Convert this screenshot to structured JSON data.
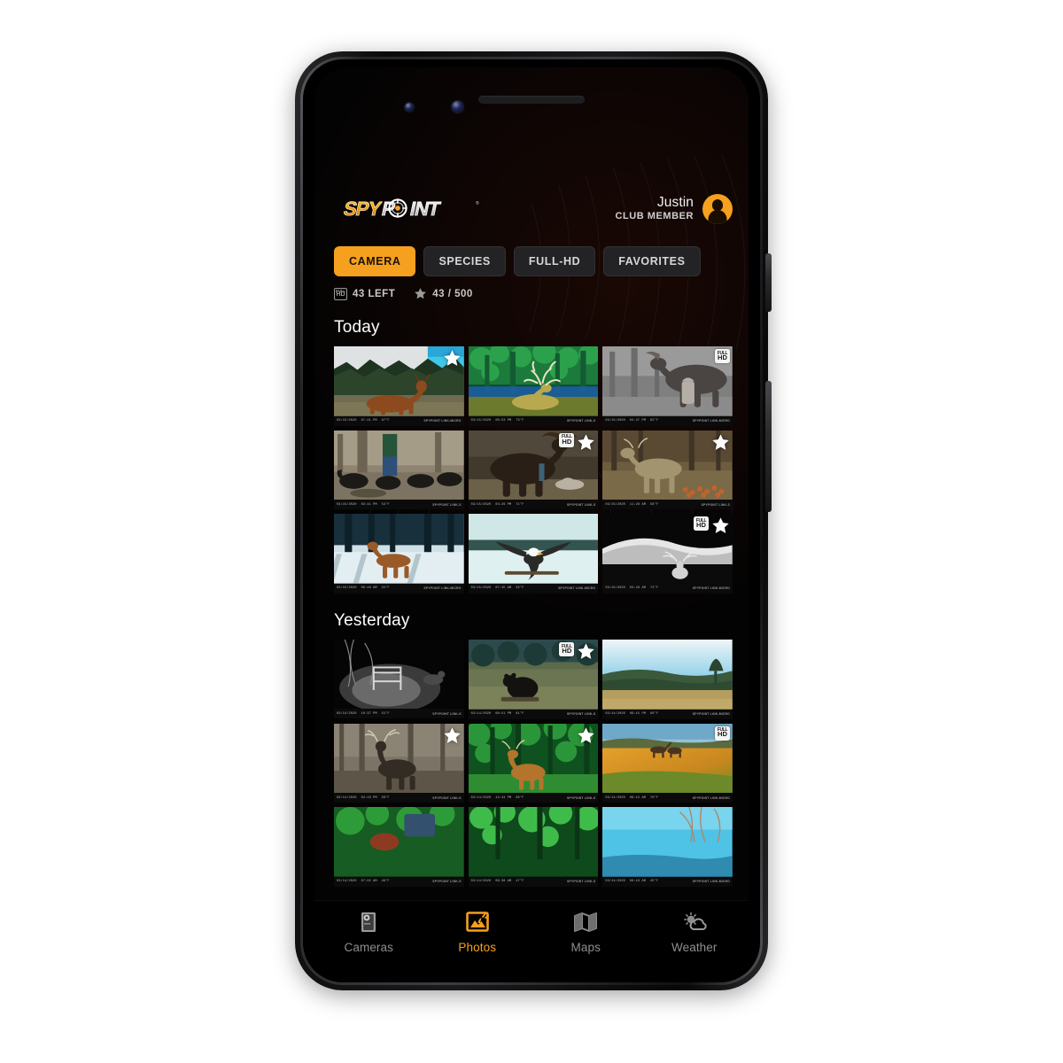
{
  "app": {
    "brand": "SPYPOINT",
    "brand_parts": {
      "orange": "SPY",
      "white": "INT",
      "target_letter": "P"
    }
  },
  "header": {
    "user_name": "Justin",
    "user_role": "CLUB MEMBER",
    "avatar_icon": "person-avatar-icon"
  },
  "filters": {
    "chips": [
      {
        "label": "CAMERA",
        "active": true
      },
      {
        "label": "SPECIES",
        "active": false
      },
      {
        "label": "FULL-HD",
        "active": false
      },
      {
        "label": "FAVORITES",
        "active": false
      }
    ]
  },
  "counters": {
    "hd": {
      "icon": "full-hd-icon",
      "label": "43 LEFT"
    },
    "favorites": {
      "icon": "star-icon",
      "label": "43 / 500"
    }
  },
  "sections": [
    {
      "title": "Today",
      "photos": [
        {
          "id": "t1",
          "scene": "buck-field-day",
          "hd": false,
          "fav": true,
          "timestamp": "03/15/2020",
          "time": "07:21 PM",
          "temp": "67°F",
          "mark": "SPYPOINT LINK-MICRO"
        },
        {
          "id": "t2",
          "scene": "buck-green-night",
          "hd": false,
          "fav": false,
          "timestamp": "03/15/2020",
          "time": "06:53 PM",
          "temp": "73°F",
          "mark": "SPYPOINT LINK-S"
        },
        {
          "id": "t3",
          "scene": "moose-gray",
          "hd": true,
          "fav": false,
          "timestamp": "03/15/2020",
          "time": "04:37 PM",
          "temp": "62°F",
          "mark": "SPYPOINT LINK-MICRO"
        },
        {
          "id": "t4",
          "scene": "boars-feeder",
          "hd": false,
          "fav": false,
          "timestamp": "03/15/2020",
          "time": "03:41 PM",
          "temp": "54°F",
          "mark": "SPYPOINT LINK-S"
        },
        {
          "id": "t5",
          "scene": "moose-dark",
          "hd": true,
          "fav": true,
          "timestamp": "03/15/2020",
          "time": "03:26 PM",
          "temp": "71°F",
          "mark": "SPYPOINT LINK-S"
        },
        {
          "id": "t6",
          "scene": "deer-apples",
          "hd": false,
          "fav": true,
          "timestamp": "03/15/2020",
          "time": "11:28 AM",
          "temp": "58°F",
          "mark": "SPYPOINT LINK-S"
        },
        {
          "id": "t7",
          "scene": "deer-snow",
          "hd": false,
          "fav": false,
          "timestamp": "03/15/2020",
          "time": "09:48 AM",
          "temp": "34°F",
          "mark": "SPYPOINT LINK-MICRO"
        },
        {
          "id": "t8",
          "scene": "eagle-snow",
          "hd": false,
          "fav": false,
          "timestamp": "03/15/2020",
          "time": "07:45 AM",
          "temp": "32°F",
          "mark": "SPYPOINT LINK-MICRO"
        },
        {
          "id": "t9",
          "scene": "buck-night-bw",
          "hd": true,
          "fav": true,
          "timestamp": "03/15/2020",
          "time": "03:28 AM",
          "temp": "72°F",
          "mark": "SPYPOINT LINK-MICRO"
        }
      ]
    },
    {
      "title": "Yesterday",
      "photos": [
        {
          "id": "y1",
          "scene": "night-stand-bw",
          "hd": false,
          "fav": false,
          "timestamp": "03/14/2020",
          "time": "10:37 PM",
          "temp": "51°F",
          "mark": "SPYPOINT LINK-S"
        },
        {
          "id": "y2",
          "scene": "bear-field",
          "hd": true,
          "fav": true,
          "timestamp": "03/14/2020",
          "time": "08:51 PM",
          "temp": "61°F",
          "mark": "SPYPOINT LINK-S"
        },
        {
          "id": "y3",
          "scene": "sky-meadow",
          "hd": false,
          "fav": false,
          "timestamp": "03/14/2020",
          "time": "06:15 PM",
          "temp": "60°F",
          "mark": "SPYPOINT LINK-MICRO"
        },
        {
          "id": "y4",
          "scene": "buck-woods-gray",
          "hd": false,
          "fav": true,
          "timestamp": "03/14/2020",
          "time": "04:19 PM",
          "temp": "58°F",
          "mark": "SPYPOINT LINK-S"
        },
        {
          "id": "y5",
          "scene": "deer-green-woods",
          "hd": false,
          "fav": true,
          "timestamp": "03/14/2020",
          "time": "12:44 PM",
          "temp": "66°F",
          "mark": "SPYPOINT LINK-S"
        },
        {
          "id": "y6",
          "scene": "horses-golden",
          "hd": true,
          "fav": false,
          "timestamp": "03/14/2020",
          "time": "08:12 AM",
          "temp": "70°F",
          "mark": "SPYPOINT LINK-MICRO"
        },
        {
          "id": "y7",
          "scene": "green-partial-a",
          "hd": false,
          "fav": false,
          "timestamp": "03/14/2020",
          "time": "07:02 AM",
          "temp": "49°F",
          "mark": "SPYPOINT LINK-S"
        },
        {
          "id": "y8",
          "scene": "green-partial-b",
          "hd": false,
          "fav": false,
          "timestamp": "03/14/2020",
          "time": "06:38 AM",
          "temp": "47°F",
          "mark": "SPYPOINT LINK-S"
        },
        {
          "id": "y9",
          "scene": "sky-partial-c",
          "hd": false,
          "fav": false,
          "timestamp": "03/14/2020",
          "time": "06:10 AM",
          "temp": "45°F",
          "mark": "SPYPOINT LINK-MICRO"
        }
      ]
    }
  ],
  "bottom_nav": [
    {
      "label": "Cameras",
      "icon": "trail-camera-icon",
      "active": false
    },
    {
      "label": "Photos",
      "icon": "photo-deer-icon",
      "active": true
    },
    {
      "label": "Maps",
      "icon": "folded-map-icon",
      "active": false
    },
    {
      "label": "Weather",
      "icon": "sun-cloud-icon",
      "active": false
    }
  ],
  "colors": {
    "accent": "#F5A01E",
    "background": "#040303",
    "chip_inactive": "#232326",
    "text_primary": "#ffffff",
    "text_muted": "#8e8e8e"
  }
}
